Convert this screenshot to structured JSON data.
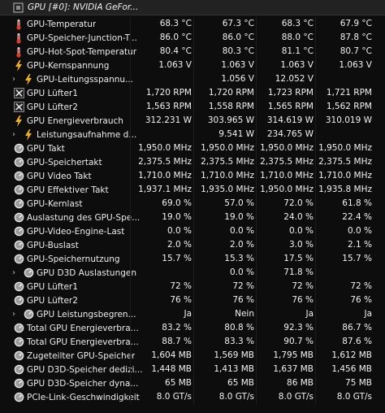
{
  "header": {
    "title": "GPU [#0]: NVIDIA GeFor..."
  },
  "rows": [
    {
      "icon": "thermometer-icon",
      "expand": false,
      "indent": 0,
      "name": "GPU-Temperatur",
      "vals": [
        "68.3 °C",
        "67.3 °C",
        "68.3 °C",
        "67.9 °C"
      ]
    },
    {
      "icon": "thermometer-icon",
      "expand": false,
      "indent": 0,
      "name": "GPU-Speicher-Junction-T...",
      "vals": [
        "86.0 °C",
        "86.0 °C",
        "88.0 °C",
        "87.8 °C"
      ]
    },
    {
      "icon": "thermometer-icon",
      "expand": false,
      "indent": 0,
      "name": "GPU-Hot-Spot-Temperatur",
      "vals": [
        "80.4 °C",
        "80.3 °C",
        "81.1 °C",
        "80.7 °C"
      ]
    },
    {
      "icon": "lightning-icon",
      "expand": false,
      "indent": 0,
      "name": "GPU-Kernspannung",
      "vals": [
        "1.063 V",
        "1.063 V",
        "1.063 V",
        "1.063 V"
      ]
    },
    {
      "icon": "lightning-icon",
      "expand": true,
      "indent": 1,
      "name": "GPU-Leitungsspannu...",
      "vals": [
        "",
        "1.056 V",
        "12.052 V",
        ""
      ]
    },
    {
      "icon": "fan-icon",
      "expand": false,
      "indent": 0,
      "name": "GPU Lüfter1",
      "vals": [
        "1,720 RPM",
        "1,720 RPM",
        "1,723 RPM",
        "1,721 RPM"
      ]
    },
    {
      "icon": "fan-icon",
      "expand": false,
      "indent": 0,
      "name": "GPU Lüfter2",
      "vals": [
        "1,563 RPM",
        "1,558 RPM",
        "1,565 RPM",
        "1,562 RPM"
      ]
    },
    {
      "icon": "lightning-icon",
      "expand": false,
      "indent": 0,
      "name": "GPU Energieverbrauch",
      "vals": [
        "312.231 W",
        "303.965 W",
        "314.619 W",
        "310.019 W"
      ]
    },
    {
      "icon": "lightning-icon",
      "expand": true,
      "indent": 1,
      "name": "Leistungsaufnahme d...",
      "vals": [
        "",
        "9.541 W",
        "234.765 W",
        ""
      ]
    },
    {
      "icon": "gauge-icon",
      "expand": false,
      "indent": 0,
      "name": "GPU Takt",
      "vals": [
        "1,950.0 MHz",
        "1,950.0 MHz",
        "1,950.0 MHz",
        "1,950.0 MHz"
      ]
    },
    {
      "icon": "gauge-icon",
      "expand": false,
      "indent": 0,
      "name": "GPU-Speichertakt",
      "vals": [
        "2,375.5 MHz",
        "2,375.5 MHz",
        "2,375.5 MHz",
        "2,375.5 MHz"
      ]
    },
    {
      "icon": "gauge-icon",
      "expand": false,
      "indent": 0,
      "name": "GPU Video Takt",
      "vals": [
        "1,710.0 MHz",
        "1,710.0 MHz",
        "1,710.0 MHz",
        "1,710.0 MHz"
      ]
    },
    {
      "icon": "gauge-icon",
      "expand": false,
      "indent": 0,
      "name": "GPU Effektiver Takt",
      "vals": [
        "1,937.1 MHz",
        "1,935.0 MHz",
        "1,950.0 MHz",
        "1,935.8 MHz"
      ]
    },
    {
      "icon": "gauge-icon",
      "expand": false,
      "indent": 0,
      "name": "GPU-Kernlast",
      "vals": [
        "69.0 %",
        "57.0 %",
        "72.0 %",
        "61.8 %"
      ]
    },
    {
      "icon": "gauge-icon",
      "expand": false,
      "indent": 0,
      "name": "Auslastung des GPU-Spe...",
      "vals": [
        "19.0 %",
        "19.0 %",
        "24.0 %",
        "22.4 %"
      ]
    },
    {
      "icon": "gauge-icon",
      "expand": false,
      "indent": 0,
      "name": "GPU-Video-Engine-Last",
      "vals": [
        "0.0 %",
        "0.0 %",
        "0.0 %",
        "0.0 %"
      ]
    },
    {
      "icon": "gauge-icon",
      "expand": false,
      "indent": 0,
      "name": "GPU-Buslast",
      "vals": [
        "2.0 %",
        "2.0 %",
        "3.0 %",
        "2.1 %"
      ]
    },
    {
      "icon": "gauge-icon",
      "expand": false,
      "indent": 0,
      "name": "GPU-Speichernutzung",
      "vals": [
        "15.7 %",
        "15.3 %",
        "17.5 %",
        "15.7 %"
      ]
    },
    {
      "icon": "gauge-icon",
      "expand": true,
      "indent": 1,
      "name": "GPU D3D Auslastungen",
      "vals": [
        "",
        "0.0 %",
        "71.8 %",
        ""
      ]
    },
    {
      "icon": "gauge-icon",
      "expand": false,
      "indent": 0,
      "name": "GPU Lüfter1",
      "vals": [
        "72 %",
        "72 %",
        "72 %",
        "72 %"
      ]
    },
    {
      "icon": "gauge-icon",
      "expand": false,
      "indent": 0,
      "name": "GPU Lüfter2",
      "vals": [
        "76 %",
        "76 %",
        "76 %",
        "76 %"
      ]
    },
    {
      "icon": "gauge-icon",
      "expand": true,
      "indent": 1,
      "name": "GPU Leistungsbegren...",
      "vals": [
        "Ja",
        "Nein",
        "Ja",
        "Ja"
      ]
    },
    {
      "icon": "gauge-icon",
      "expand": false,
      "indent": 0,
      "name": "Total GPU Energieverbra...",
      "vals": [
        "83.2 %",
        "80.8 %",
        "92.3 %",
        "86.7 %"
      ]
    },
    {
      "icon": "gauge-icon",
      "expand": false,
      "indent": 0,
      "name": "Total GPU Energieverbra...",
      "vals": [
        "88.7 %",
        "83.3 %",
        "90.7 %",
        "87.6 %"
      ]
    },
    {
      "icon": "gauge-icon",
      "expand": false,
      "indent": 0,
      "name": "Zugeteilter GPU-Speicher",
      "vals": [
        "1,604 MB",
        "1,569 MB",
        "1,795 MB",
        "1,612 MB"
      ]
    },
    {
      "icon": "gauge-icon",
      "expand": false,
      "indent": 0,
      "name": "GPU D3D-Speicher dedizi...",
      "vals": [
        "1,448 MB",
        "1,413 MB",
        "1,637 MB",
        "1,456 MB"
      ]
    },
    {
      "icon": "gauge-icon",
      "expand": false,
      "indent": 0,
      "name": "GPU D3D-Speicher dyna...",
      "vals": [
        "65 MB",
        "65 MB",
        "86 MB",
        "75 MB"
      ]
    },
    {
      "icon": "gauge-icon",
      "expand": false,
      "indent": 0,
      "name": "PCIe-Link-Geschwindigkeit",
      "vals": [
        "8.0 GT/s",
        "8.0 GT/s",
        "8.0 GT/s",
        "8.0 GT/s"
      ]
    }
  ]
}
